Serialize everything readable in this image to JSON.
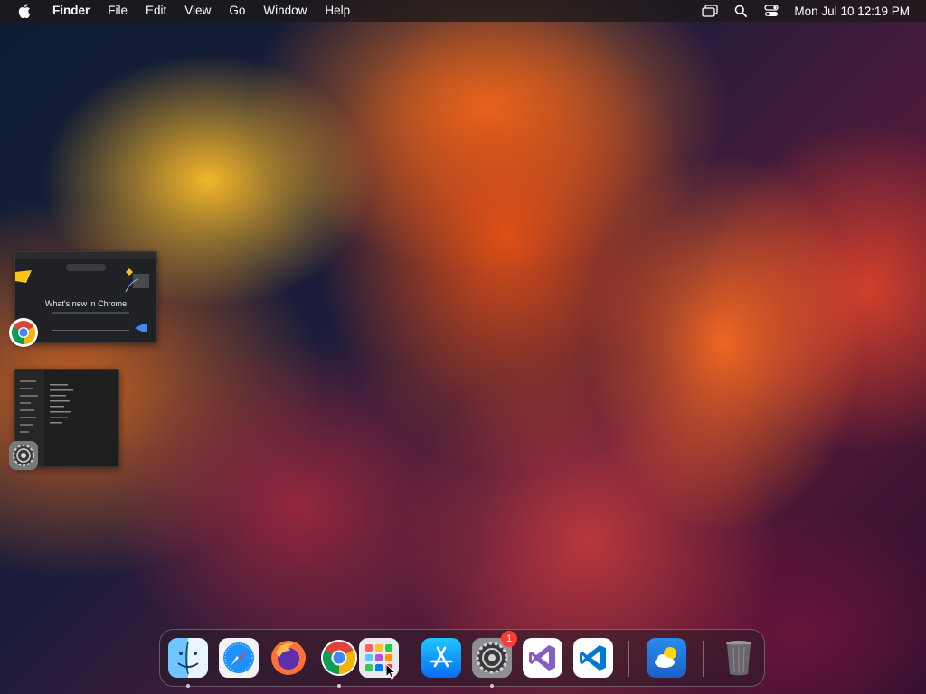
{
  "menubar": {
    "apple_icon": "apple-icon",
    "app_name": "Finder",
    "items": [
      "File",
      "Edit",
      "View",
      "Go",
      "Window",
      "Help"
    ],
    "status_icons": [
      "screen-mirroring-icon",
      "search-icon",
      "control-center-icon"
    ],
    "clock": "Mon Jul 10  12:19 PM"
  },
  "thumbnails": {
    "chrome": {
      "icon": "chrome-icon",
      "heading": "What's new in Chrome"
    },
    "settings": {
      "icon": "system-settings-icon"
    }
  },
  "dock": {
    "apps": [
      {
        "name": "Finder",
        "icon": "finder-icon",
        "running": true
      },
      {
        "name": "Safari",
        "icon": "safari-icon",
        "running": false
      },
      {
        "name": "Firefox",
        "icon": "firefox-icon",
        "running": false
      },
      {
        "name": "Google Chrome",
        "icon": "chrome-icon",
        "running": true
      },
      {
        "name": "Launchpad",
        "icon": "launchpad-icon",
        "running": false
      },
      {
        "name": "App Store",
        "icon": "app-store-icon",
        "running": false
      },
      {
        "name": "System Settings",
        "icon": "system-settings-icon",
        "running": true,
        "badge": "1"
      },
      {
        "name": "Visual Studio",
        "icon": "visual-studio-icon",
        "running": false
      },
      {
        "name": "Visual Studio Code",
        "icon": "vscode-icon",
        "running": false
      },
      {
        "name": "Weather",
        "icon": "weather-icon",
        "running": false
      },
      {
        "name": "Trash",
        "icon": "trash-icon",
        "running": false
      }
    ]
  },
  "colors": {
    "badge": "#ff3b30",
    "menubar_bg": "#1e181a"
  }
}
